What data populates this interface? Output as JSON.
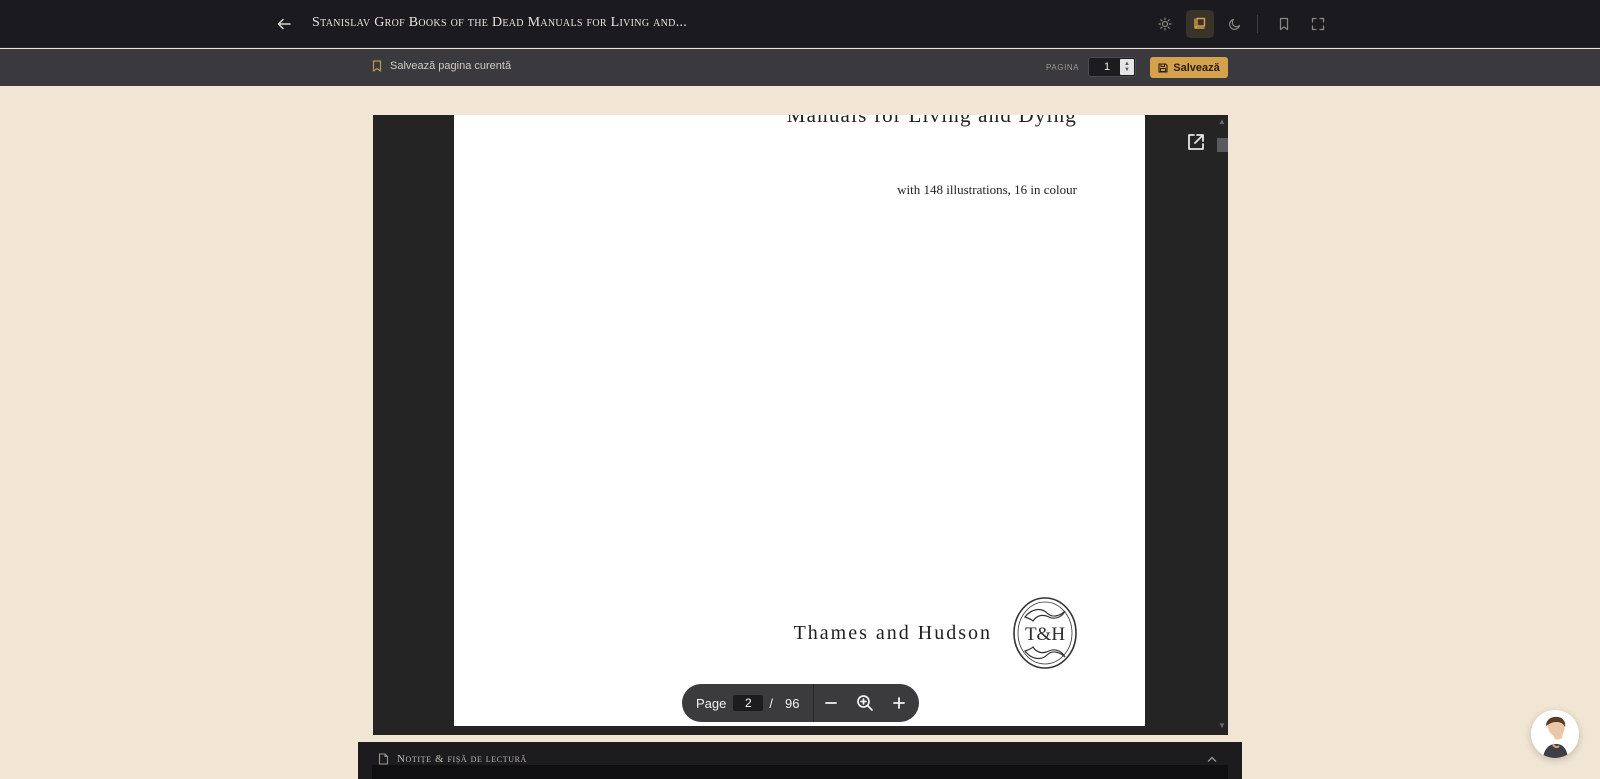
{
  "header": {
    "title": "Stanislav Grof Books of the Dead Manuals for Living and...",
    "icons": [
      "arrow-left-icon",
      "sun-icon",
      "book-open-icon",
      "moon-icon",
      "bookmark-icon",
      "fullscreen-icon"
    ],
    "active_mode": "book-open-icon"
  },
  "subbar": {
    "save_current_label": "Salvează pagina curentă",
    "pagina_label": "PAGINA",
    "pagina_value": "1",
    "save_button_label": "Salvează"
  },
  "pdf": {
    "heading": "Manuals for Living and Dying",
    "illustrations": "with 148 illustrations, 16 in colour",
    "publisher": "Thames and Hudson",
    "logo_text": "T&H"
  },
  "page_control": {
    "label": "Page",
    "current": "2",
    "separator": "/",
    "total": "96"
  },
  "notes": {
    "title": "Notițe & fișă de lectură"
  },
  "colors": {
    "background": "#f1e6d3",
    "topbar": "#1b1b1f",
    "accent": "#d4a24c"
  }
}
